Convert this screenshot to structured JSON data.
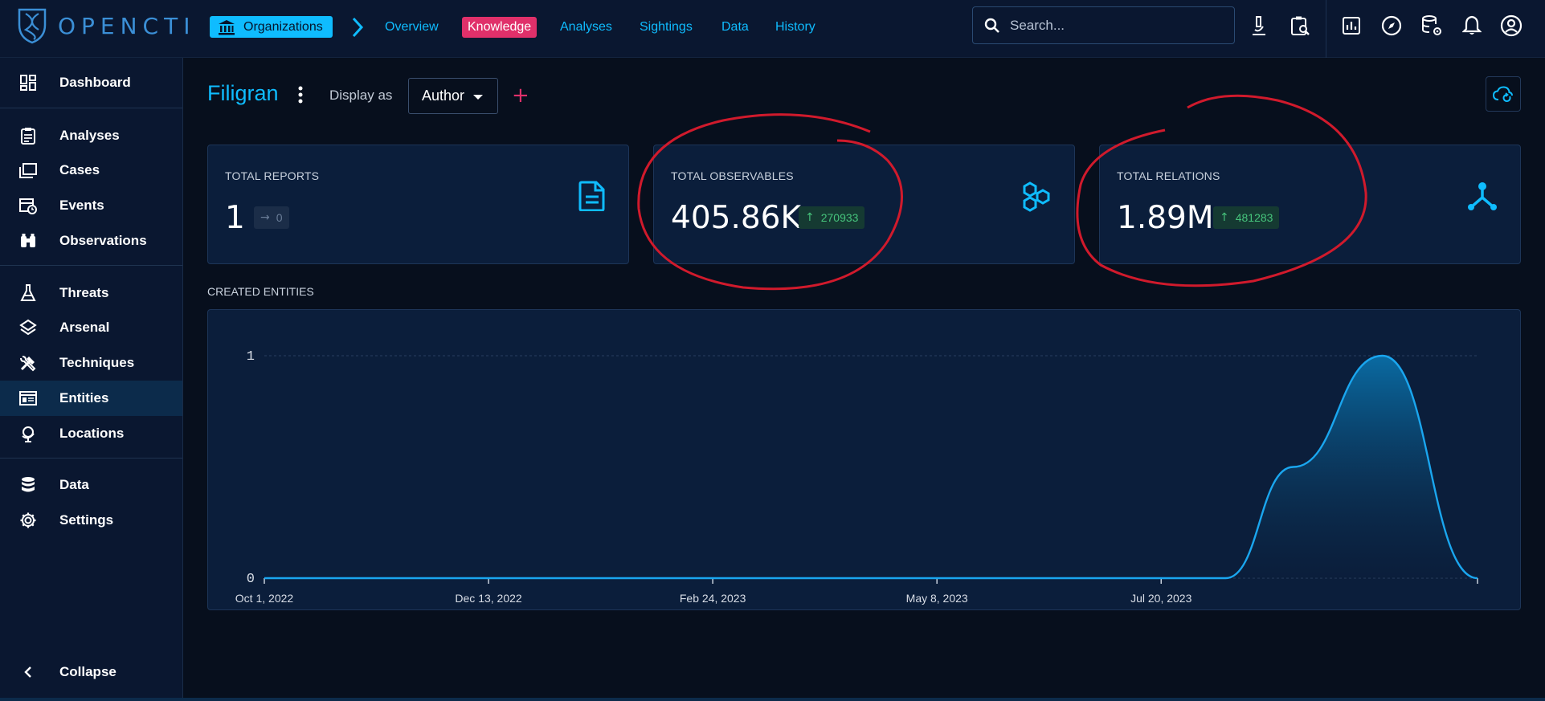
{
  "app": {
    "brand": "OPENCTI"
  },
  "breadcrumb": {
    "section": "Organizations"
  },
  "nav_tabs": [
    {
      "label": "Overview",
      "active": false
    },
    {
      "label": "Knowledge",
      "active": true
    },
    {
      "label": "Analyses",
      "active": false
    },
    {
      "label": "Sightings",
      "active": false
    },
    {
      "label": "Data",
      "active": false
    },
    {
      "label": "History",
      "active": false
    }
  ],
  "search": {
    "placeholder": "Search..."
  },
  "topbar_icons": [
    "microscope-icon",
    "clipboard-search-icon",
    "dashboard-chart-icon",
    "explore-compass-icon",
    "database-settings-icon",
    "notifications-bell-icon",
    "account-icon"
  ],
  "sidebar": {
    "items": [
      {
        "label": "Dashboard",
        "icon": "dashboard-icon",
        "selected": false
      },
      {
        "label": "Analyses",
        "icon": "analyses-icon",
        "selected": false
      },
      {
        "label": "Cases",
        "icon": "cases-icon",
        "selected": false
      },
      {
        "label": "Events",
        "icon": "events-icon",
        "selected": false
      },
      {
        "label": "Observations",
        "icon": "binoculars-icon",
        "selected": false
      },
      {
        "label": "Threats",
        "icon": "threats-flask-icon",
        "selected": false
      },
      {
        "label": "Arsenal",
        "icon": "arsenal-layers-icon",
        "selected": false
      },
      {
        "label": "Techniques",
        "icon": "techniques-tools-icon",
        "selected": false
      },
      {
        "label": "Entities",
        "icon": "entities-icon",
        "selected": true
      },
      {
        "label": "Locations",
        "icon": "locations-globe-icon",
        "selected": false
      },
      {
        "label": "Data",
        "icon": "data-database-icon",
        "selected": false
      },
      {
        "label": "Settings",
        "icon": "settings-gear-icon",
        "selected": false
      }
    ],
    "collapse_label": "Collapse"
  },
  "entity": {
    "title": "Filigran",
    "display_as_label": "Display as",
    "display_as_value": "Author"
  },
  "stats": [
    {
      "title": "TOTAL REPORTS",
      "value": "1",
      "delta": "0",
      "trend": "flat",
      "icon": "report-document-icon"
    },
    {
      "title": "TOTAL OBSERVABLES",
      "value": "405.86K",
      "delta": "270933",
      "trend": "up",
      "icon": "observables-hexagons-icon"
    },
    {
      "title": "TOTAL RELATIONS",
      "value": "1.89M",
      "delta": "481283",
      "trend": "up",
      "icon": "relations-graph-icon"
    }
  ],
  "section": {
    "created_entities_label": "CREATED ENTITIES"
  },
  "colors": {
    "accent": "#0fbcff",
    "knowledge_tab": "#e0306a",
    "positive": "#46c47c",
    "annotation": "#d01a2c"
  },
  "chart_data": {
    "type": "area",
    "title": "",
    "xlabel": "",
    "ylabel": "",
    "x_ticks": [
      "Oct 1, 2022",
      "Dec 13, 2022",
      "Feb 24, 2023",
      "May 8, 2023",
      "Jul 20, 2023"
    ],
    "y_ticks": [
      "0",
      "1"
    ],
    "ylim": [
      0,
      1
    ],
    "xlim": [
      "2022-10-01",
      "2023-10-31"
    ],
    "series": [
      {
        "x": [
          "2022-10-01",
          "2023-07-20",
          "2023-08-10",
          "2023-09-01",
          "2023-09-30",
          "2023-10-31"
        ],
        "values": [
          0,
          0,
          0,
          0.5,
          1,
          0
        ]
      }
    ]
  }
}
